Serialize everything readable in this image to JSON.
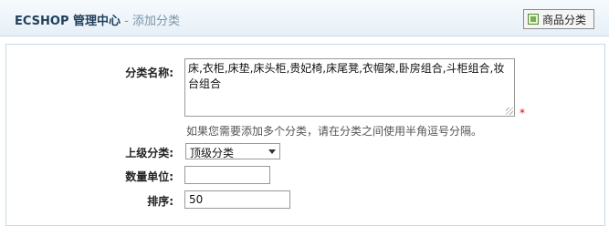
{
  "header": {
    "brand": "ECSHOP 管理中心",
    "subtitle": " - 添加分类",
    "list_button_label": "商品分类"
  },
  "form": {
    "category_name": {
      "label": "分类名称:",
      "value": "床,衣柜,床垫,床头柜,贵妃椅,床尾凳,衣帽架,卧房组合,斗柜组合,妆台组合",
      "required_mark": "*",
      "hint": "如果您需要添加多个分类，请在分类之间使用半角逗号分隔。"
    },
    "parent": {
      "label": "上级分类:",
      "selected": "顶级分类"
    },
    "unit": {
      "label": "数量单位:",
      "value": ""
    },
    "sort": {
      "label": "排序:",
      "value": "50"
    }
  }
}
